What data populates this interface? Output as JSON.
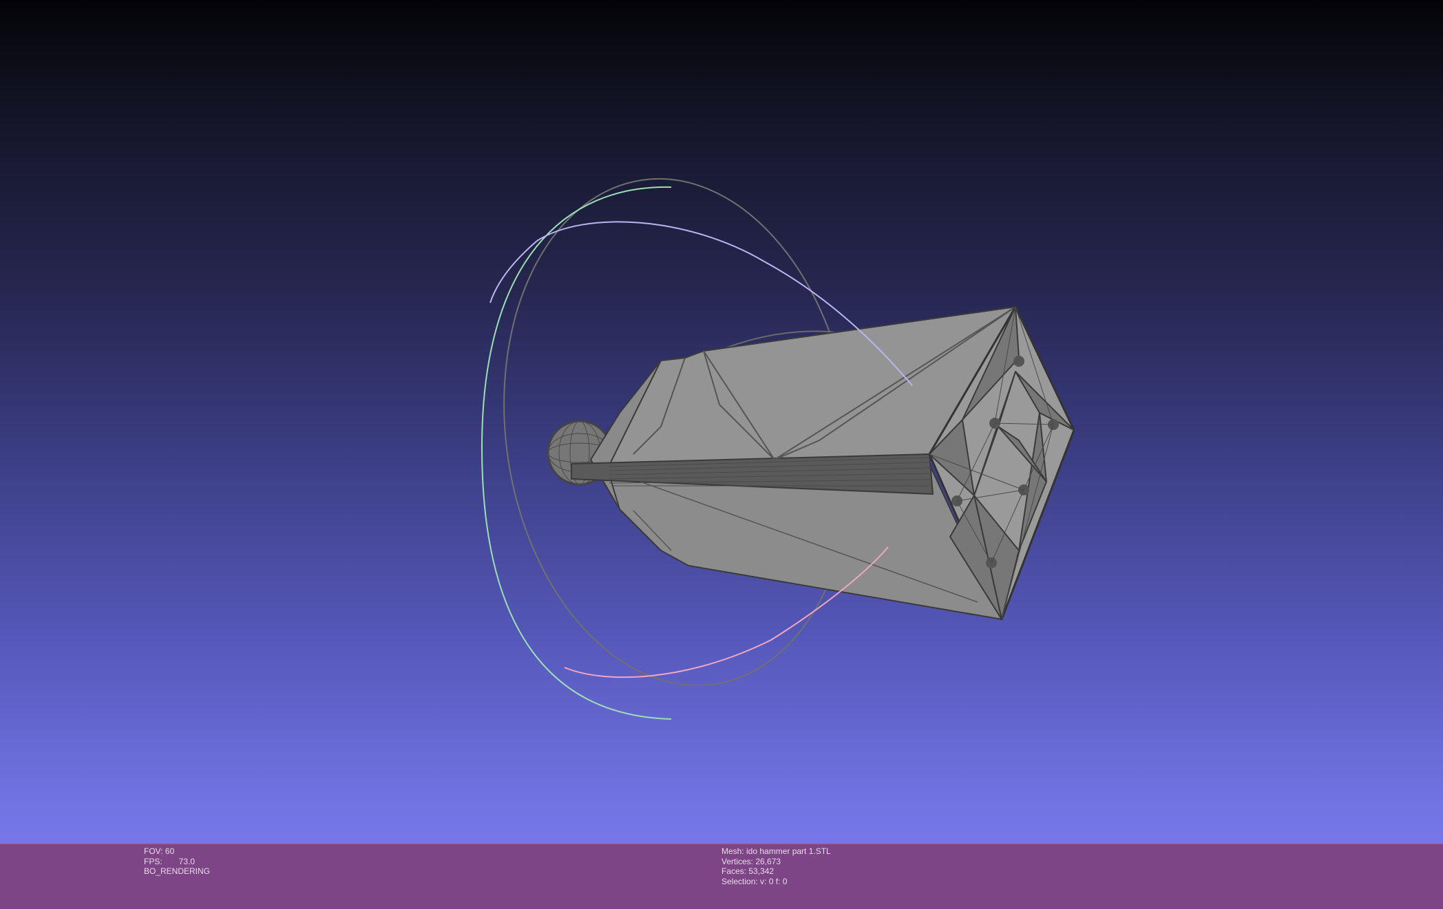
{
  "window": {
    "background_top": "#040407",
    "background_bottom": "#7676e8",
    "info_bar_color": "#7d4585"
  },
  "info_left": {
    "fov_label": "FOV:",
    "fov_value": "60",
    "fps_label": "FPS:",
    "fps_value": "73.0",
    "render_mode": "BO_RENDERING"
  },
  "info_mesh": {
    "mesh": "Mesh: ido hammer part 1.STL",
    "vertices": "Vertices: 26,673",
    "faces": "Faces: 53,342",
    "selection": "Selection: v: 0 f: 0"
  },
  "trackball": {
    "ring_colors": [
      "#9be0b5",
      "#b9b6f2",
      "#f1a7c3",
      "#7a7a7a"
    ]
  },
  "mesh_colors": {
    "face": "#8e8e8e",
    "face_light": "#9a9a9a",
    "face_dark": "#5c5c5c",
    "edge": "#3a3a3a"
  }
}
